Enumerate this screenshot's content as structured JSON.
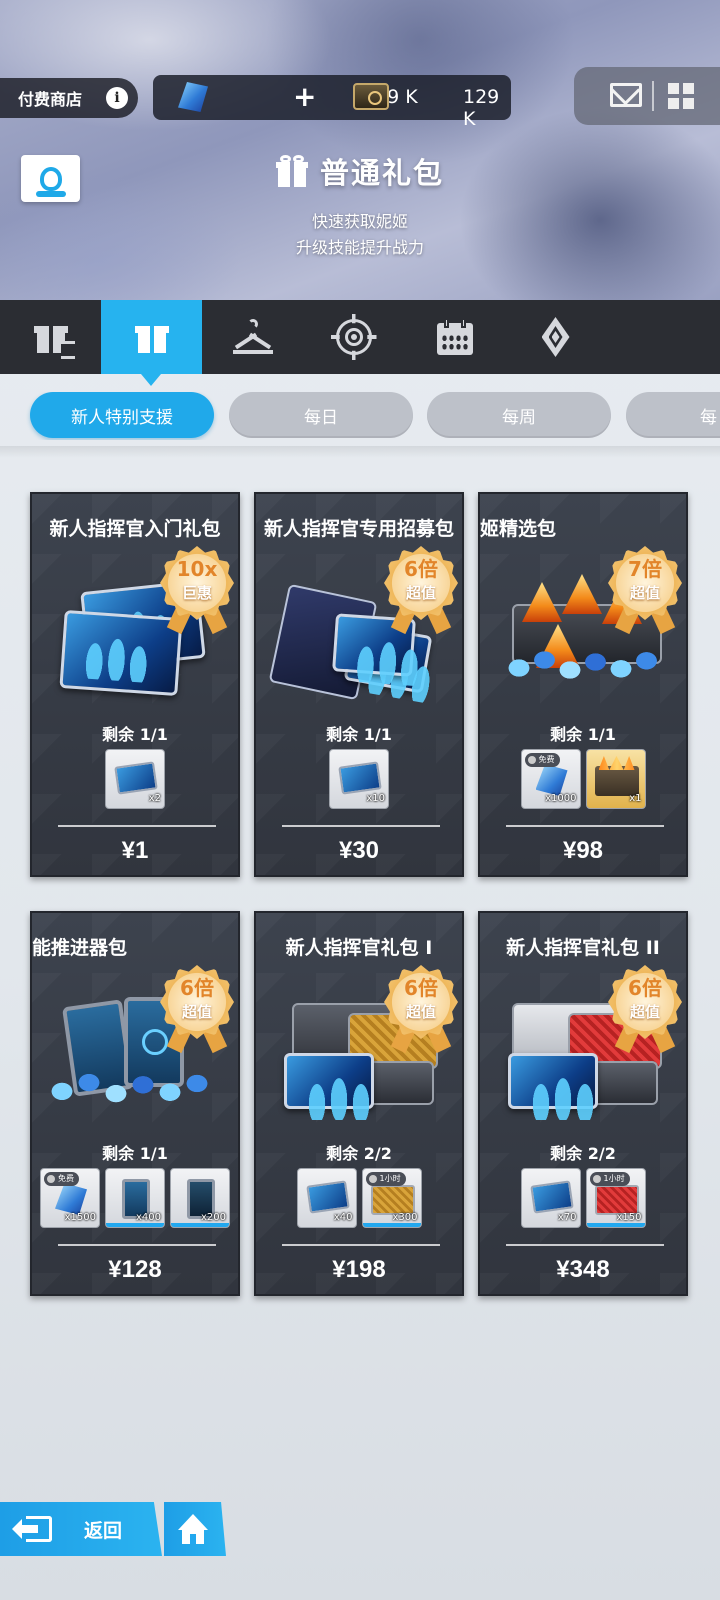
{
  "header": {
    "shop_label": "付费商店",
    "info_glyph": "i",
    "currency": {
      "gems": "159 K",
      "plus": "+",
      "tickets": "129 K"
    },
    "title": "普通礼包",
    "subtitle_lines": [
      "快速获取妮姬",
      "升级技能提升战力"
    ]
  },
  "category_tabs": [
    {
      "icon": "gift-timer-icon",
      "active": false
    },
    {
      "icon": "gift-icon",
      "active": true
    },
    {
      "icon": "hanger-icon",
      "active": false
    },
    {
      "icon": "target-icon",
      "active": false
    },
    {
      "icon": "calendar-icon",
      "active": false
    },
    {
      "icon": "diamond-icon",
      "active": false
    }
  ],
  "sub_tabs": [
    {
      "label": "新人特别支援",
      "active": true
    },
    {
      "label": "每日",
      "active": false
    },
    {
      "label": "每周",
      "active": false
    },
    {
      "label": "每",
      "active": false
    }
  ],
  "remain_prefix": "剩余",
  "products": [
    {
      "title": "新人指挥官入门礼包",
      "badge_top": "10x",
      "badge_bottom": "巨惠",
      "remain": "1/1",
      "items": [
        {
          "icon": "recruit-card-icon",
          "qty": "x2"
        }
      ],
      "price": "¥1"
    },
    {
      "title": "新人指挥官专用招募包",
      "badge_top": "6倍",
      "badge_bottom": "超值",
      "remain": "1/1",
      "items": [
        {
          "icon": "recruit-card-icon",
          "qty": "x10"
        }
      ],
      "price": "¥30"
    },
    {
      "title": "姬精选包",
      "badge_top": "7倍",
      "badge_bottom": "超值",
      "remain": "1/1",
      "items": [
        {
          "icon": "gem-icon",
          "qty": "x1000",
          "tag": "免费"
        },
        {
          "icon": "chest-icon",
          "qty": "x1"
        }
      ],
      "price": "¥98"
    },
    {
      "title": "能推进器包",
      "badge_top": "6倍",
      "badge_bottom": "超值",
      "remain": "1/1",
      "items": [
        {
          "icon": "gem-icon",
          "qty": "x1500",
          "tag": "免费"
        },
        {
          "icon": "tablet-icon",
          "qty": "x400"
        },
        {
          "icon": "tablet-dark-icon",
          "qty": "x200"
        }
      ],
      "price": "¥128"
    },
    {
      "title": "新人指挥官礼包 I",
      "badge_top": "6倍",
      "badge_bottom": "超值",
      "remain": "2/2",
      "items": [
        {
          "icon": "recruit-card-icon",
          "qty": "x40"
        },
        {
          "icon": "gold-case-icon",
          "qty": "x300",
          "tag": "1小时"
        }
      ],
      "price": "¥198"
    },
    {
      "title": "新人指挥官礼包 II",
      "badge_top": "6倍",
      "badge_bottom": "超值",
      "remain": "2/2",
      "items": [
        {
          "icon": "recruit-card-icon",
          "qty": "x70"
        },
        {
          "icon": "red-case-icon",
          "qty": "x150",
          "tag": "1小时"
        }
      ],
      "price": "¥348"
    }
  ],
  "footer": {
    "back_label": "返回"
  }
}
